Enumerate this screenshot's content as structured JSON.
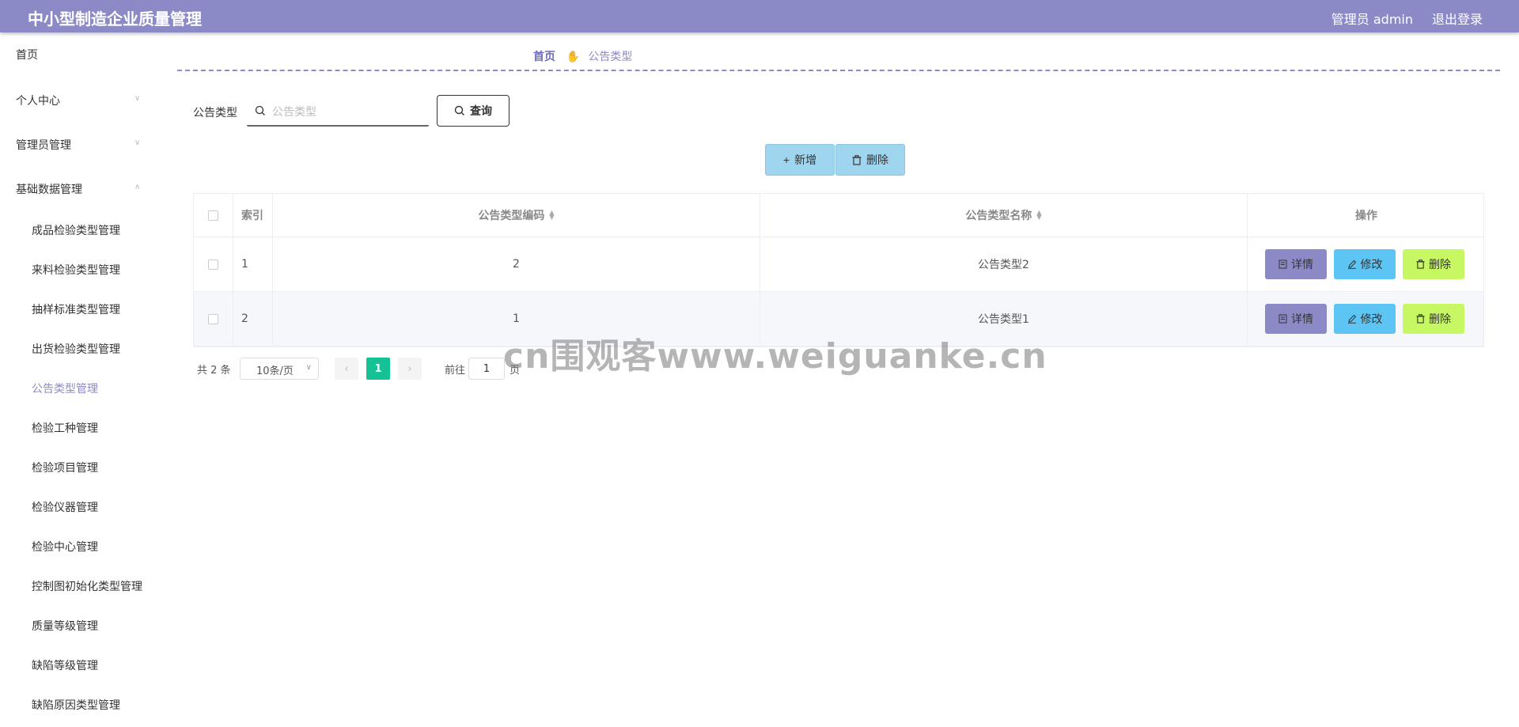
{
  "header": {
    "title": "中小型制造企业质量管理",
    "user": "管理员 admin",
    "logout": "退出登录"
  },
  "sidebar": {
    "items": [
      {
        "label": "首页"
      },
      {
        "label": "个人中心"
      },
      {
        "label": "管理员管理"
      },
      {
        "label": "基础数据管理"
      }
    ],
    "sub_items": [
      {
        "label": "成品检验类型管理"
      },
      {
        "label": "来料检验类型管理"
      },
      {
        "label": "抽样标准类型管理"
      },
      {
        "label": "出货检验类型管理"
      },
      {
        "label": "公告类型管理"
      },
      {
        "label": "检验工种管理"
      },
      {
        "label": "检验项目管理"
      },
      {
        "label": "检验仪器管理"
      },
      {
        "label": "检验中心管理"
      },
      {
        "label": "控制图初始化类型管理"
      },
      {
        "label": "质量等级管理"
      },
      {
        "label": "缺陷等级管理"
      },
      {
        "label": "缺陷原因类型管理"
      }
    ]
  },
  "breadcrumb": {
    "home": "首页",
    "current": "公告类型"
  },
  "search": {
    "label": "公告类型",
    "placeholder": "公告类型",
    "value": "",
    "button": "查询"
  },
  "actions": {
    "add": "新增",
    "delete": "删除"
  },
  "table": {
    "columns": [
      "索引",
      "公告类型编码",
      "公告类型名称",
      "操作"
    ],
    "rows": [
      {
        "index": "1",
        "code": "2",
        "name": "公告类型2"
      },
      {
        "index": "2",
        "code": "1",
        "name": "公告类型1"
      }
    ],
    "ops": {
      "detail": "详情",
      "edit": "修改",
      "delete": "删除"
    }
  },
  "pagination": {
    "total": "共 2 条",
    "page_size": "10条/页",
    "current_page": "1",
    "goto_label": "前往",
    "goto_value": "1",
    "goto_unit": "页"
  },
  "watermark": "cn围观客www.weiguanke.cn",
  "colors": {
    "header": "#8b8ac6",
    "active_menu": "#8b8ac6",
    "action_button": "#9fd5ee",
    "detail_button": "#8b8ac6",
    "edit_button": "#5cc5f4",
    "delete_button": "#c7f864",
    "current_page": "#15c295"
  }
}
